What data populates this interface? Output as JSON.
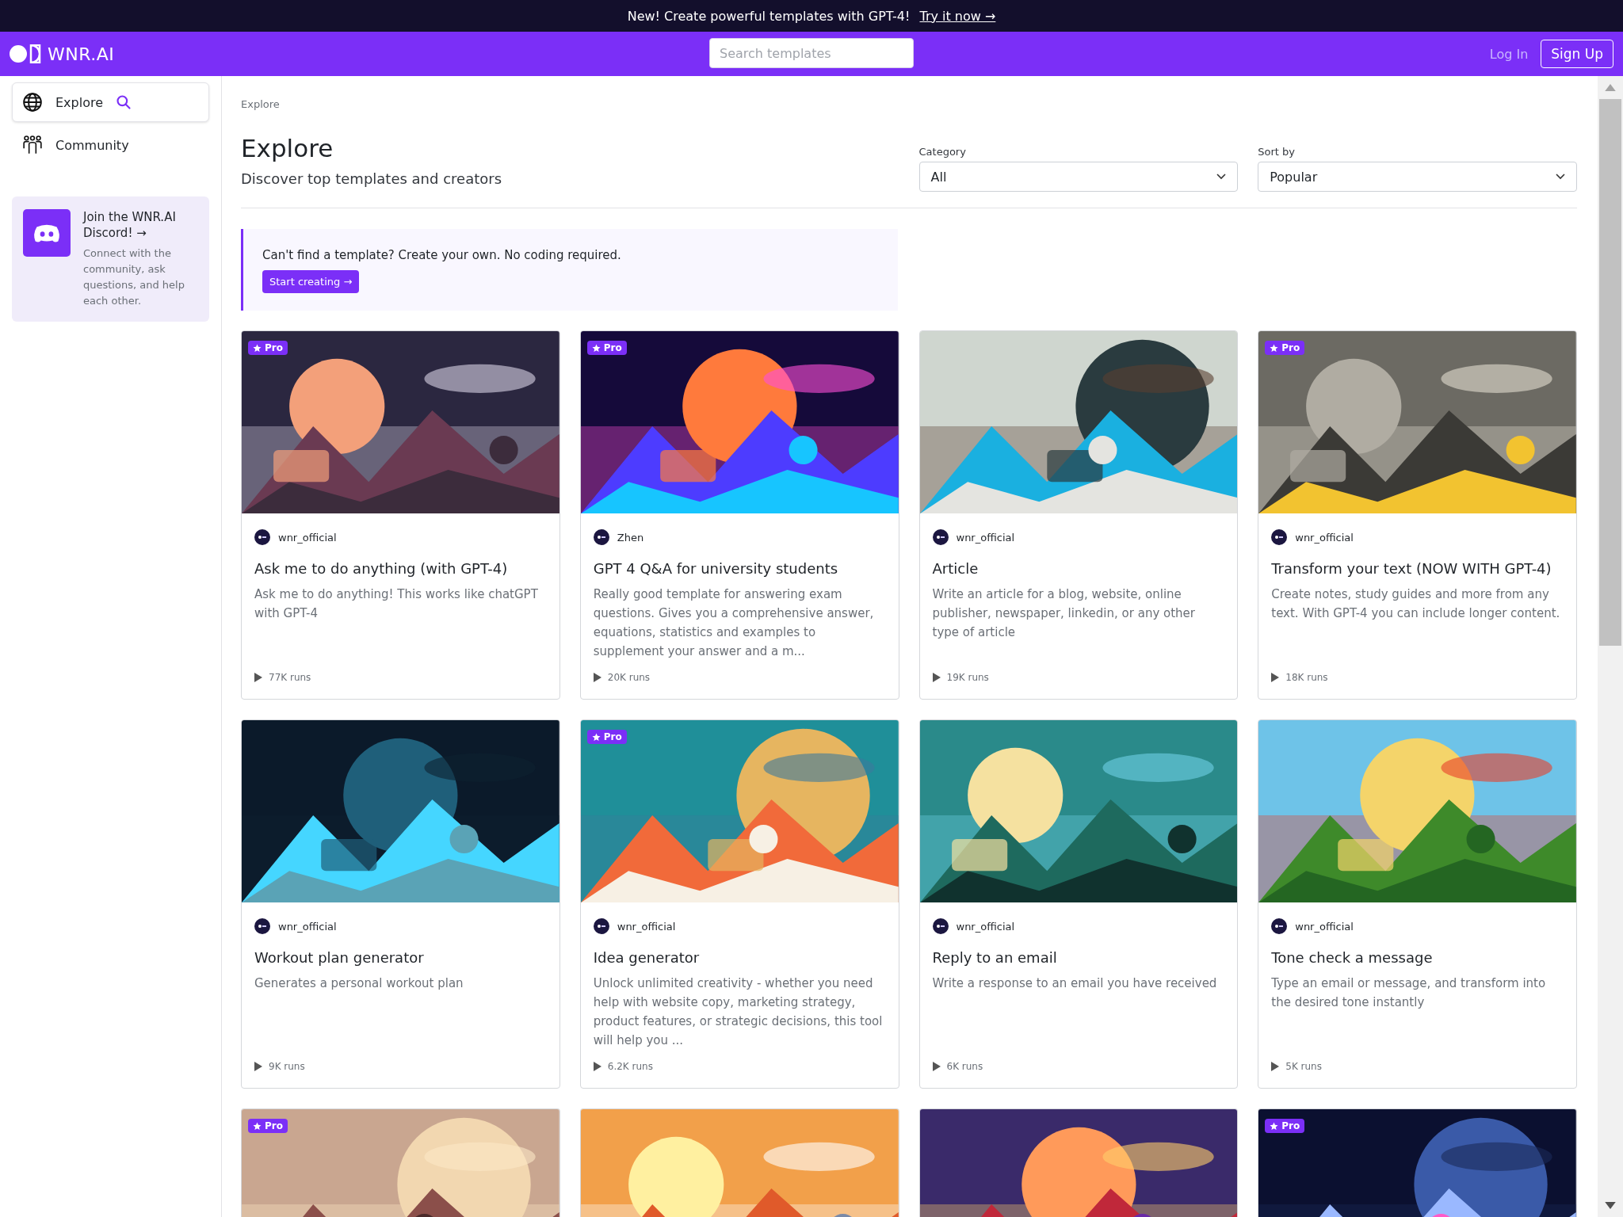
{
  "announcement": {
    "text": "New! Create powerful templates with GPT-4!",
    "link": "Try it now →"
  },
  "header": {
    "brand": "WNR.AI",
    "search": {
      "placeholder": "Search templates"
    },
    "login": "Log In",
    "signup": "Sign Up"
  },
  "sidebar": {
    "items": [
      {
        "label": "Explore",
        "selected": true,
        "kind": "explore"
      },
      {
        "label": "Community",
        "selected": false,
        "kind": "community"
      }
    ],
    "promo": {
      "title": "Join the WNR.AI Discord! →",
      "text": "Connect with the community, ask questions, and help each other."
    }
  },
  "breadcrumb": "Explore",
  "page": {
    "title": "Explore",
    "subtitle": "Discover top templates and creators"
  },
  "filters": [
    {
      "label": "Category",
      "value": "All"
    },
    {
      "label": "Sort by",
      "value": "Popular"
    }
  ],
  "cta": {
    "text": "Can't find a template? Create your own. No coding required.",
    "button": "Start creating →"
  },
  "cards": [
    {
      "badge": "Pro",
      "author": "wnr_official",
      "title": "Ask me to do anything (with GPT-4)",
      "description": "Ask me to do anything! This works like chatGPT with GPT-4",
      "runs": "77K runs"
    },
    {
      "badge": "Pro",
      "author": "Zhen",
      "title": "GPT 4 Q&A for university students",
      "description": "Really good template for answering exam questions. Gives you a comprehensive answer, equations, statistics and examples to supplement your answer and a m...",
      "runs": "20K runs"
    },
    {
      "author": "wnr_official",
      "title": "Article",
      "description": "Write an article for a blog, website, online publisher, newspaper, linkedin, or any other type of article",
      "runs": "19K runs"
    },
    {
      "badge": "Pro",
      "author": "wnr_official",
      "title": "Transform your text (NOW WITH GPT-4)",
      "description": "Create notes, study guides and more from any text. With GPT-4 you can include longer content.",
      "runs": "18K runs"
    },
    {
      "author": "wnr_official",
      "title": "Workout plan generator",
      "description": "Generates a personal workout plan",
      "runs": "9K runs"
    },
    {
      "badge": "Pro",
      "author": "wnr_official",
      "title": "Idea generator",
      "description": "Unlock unlimited creativity - whether you need help with website copy, marketing strategy, product features, or strategic decisions, this tool will help you ...",
      "runs": "6.2K runs"
    },
    {
      "author": "wnr_official",
      "title": "Reply to an email",
      "description": "Write a response to an email you have received",
      "runs": "6K runs"
    },
    {
      "author": "wnr_official",
      "title": "Tone check a message",
      "description": "Type an email or message, and transform into the desired tone instantly",
      "runs": "5K runs"
    },
    {
      "badge": "Pro",
      "kind": "picture"
    },
    {
      "kind": "picture"
    },
    {
      "kind": "picture"
    },
    {
      "badge": "Pro",
      "kind": "picture"
    }
  ]
}
